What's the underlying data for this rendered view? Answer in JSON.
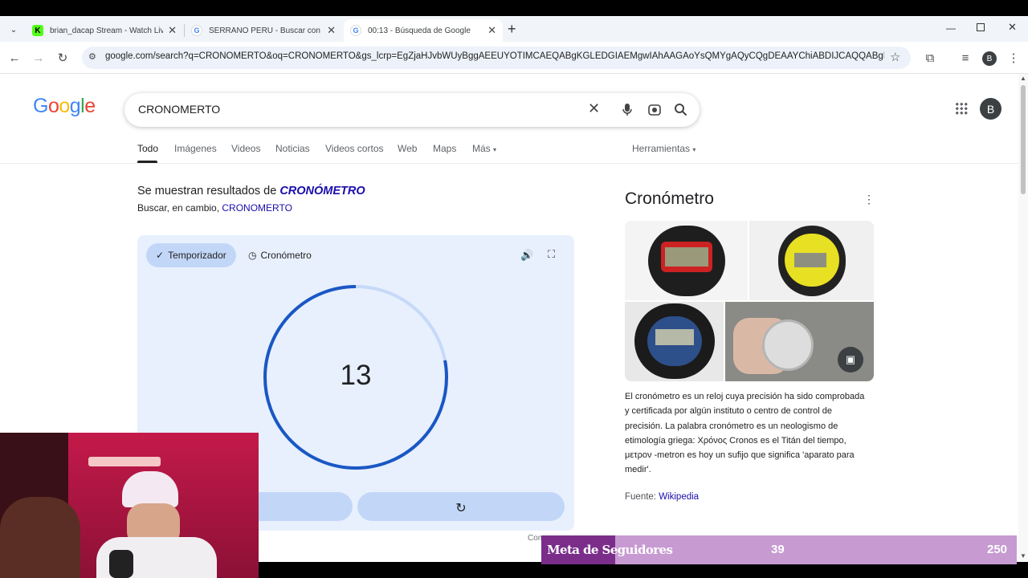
{
  "browser": {
    "tabs": [
      {
        "title": "brian_dacap Stream - Watch Liv",
        "favicon": "kick-icon",
        "active": false
      },
      {
        "title": "SERRANO PERU - Buscar con G",
        "favicon": "google-icon",
        "active": false
      },
      {
        "title": "00:13 - Búsqueda de Google",
        "favicon": "google-icon",
        "active": true
      }
    ],
    "new_tab_label": "+",
    "url": "google.com/search?q=CRONOMERTO&oq=CRONOMERTO&gs_lcrp=EgZjaHJvbWUyBggAEEUYOTIMCAEQABgKGLEDGIAEMgwIAhAAGAoYsQMYgAQyCQgDEAAYChiABDIJCAQQABgKGIAE...",
    "profile_initial": "B"
  },
  "search": {
    "query": "CRONOMERTO",
    "logo": "Google",
    "nav": [
      "Todo",
      "Imágenes",
      "Videos",
      "Noticias",
      "Videos cortos",
      "Web",
      "Maps",
      "Más"
    ],
    "tools": "Herramientas",
    "profile_initial": "B"
  },
  "correction": {
    "prefix": "Se muestran resultados de ",
    "corrected": "CRONÓMETRO",
    "instead_prefix": "Buscar, en cambio, ",
    "instead": "CRONOMERTO"
  },
  "timer_widget": {
    "tab_timer": "Temporizador",
    "tab_stopwatch": "Cronómetro",
    "value": "13",
    "progress_fraction": 0.78,
    "footer_partial": "Com"
  },
  "knowledge_panel": {
    "title": "Cronómetro",
    "description": "El cronómetro es un reloj cuya precisión ha sido comprobada y certificada por algún instituto o centro de control de precisión. La palabra cronómetro es un neologismo de etimología griega: Χρόνος Cronos es el Titán del tiempo, μετρον -metron es hoy un sufijo que significa 'aparato para medir'.",
    "source_label": "Fuente: ",
    "source": "Wikipedia"
  },
  "overlay": {
    "goal_label": "Meta de Seguidores",
    "current": "39",
    "target": "250",
    "progress_fraction": 0.156
  }
}
